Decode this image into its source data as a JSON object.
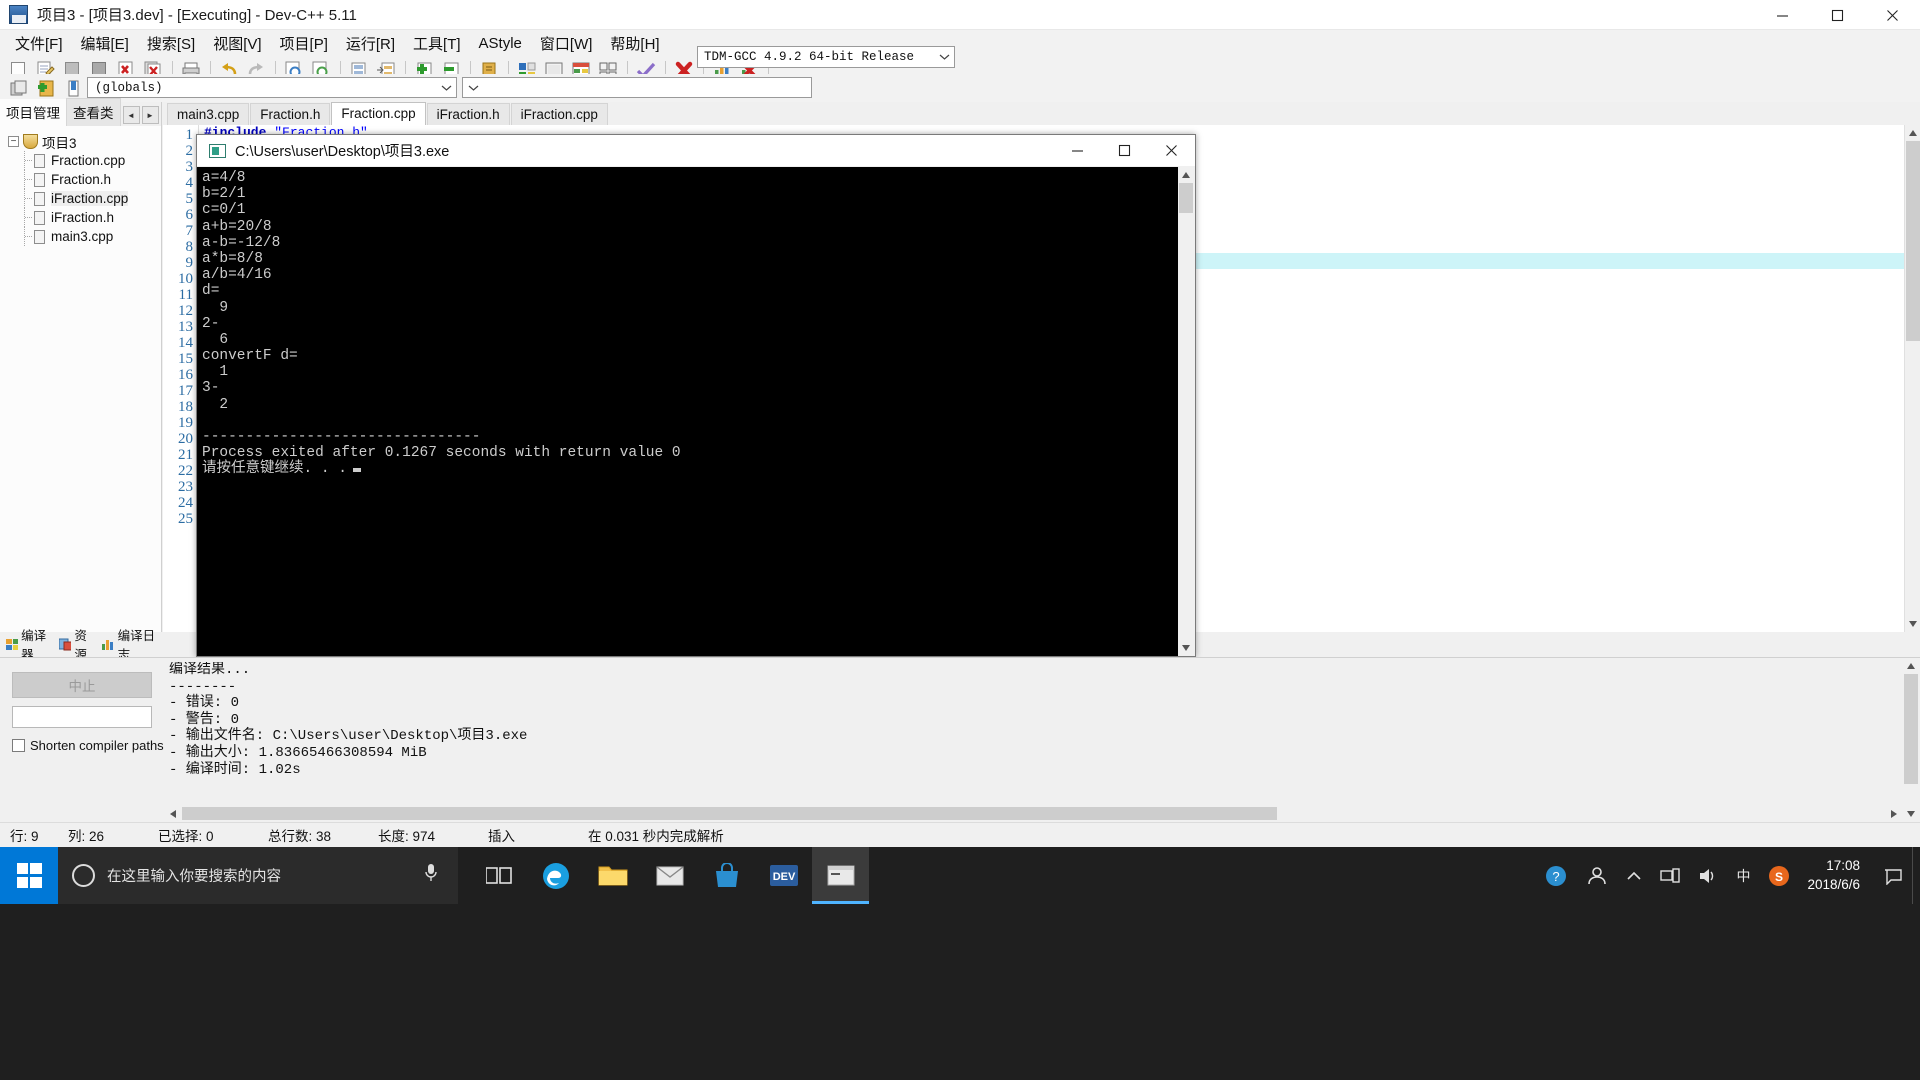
{
  "window": {
    "title": "项目3 - [项目3.dev] - [Executing] - Dev-C++ 5.11",
    "icon": "devcpp-icon",
    "minimize": "minimize-button",
    "maximize": "maximize-button",
    "close": "close-button"
  },
  "menubar": {
    "items": [
      {
        "label": "文件[F]"
      },
      {
        "label": "编辑[E]"
      },
      {
        "label": "搜索[S]"
      },
      {
        "label": "视图[V]"
      },
      {
        "label": "项目[P]"
      },
      {
        "label": "运行[R]"
      },
      {
        "label": "工具[T]"
      },
      {
        "label": "AStyle"
      },
      {
        "label": "窗口[W]"
      },
      {
        "label": "帮助[H]"
      }
    ]
  },
  "toolbar": {
    "compiler_combo": {
      "value": "TDM-GCC 4.9.2 64-bit Release",
      "arrow": "chevron-down-icon"
    },
    "globals_combo": {
      "value": "(globals)",
      "arrow": "chevron-down-icon"
    },
    "globals_combo2": {
      "value": "",
      "arrow": "chevron-down-icon"
    }
  },
  "left_panel": {
    "tabs": [
      {
        "label": "项目管理",
        "active": true
      },
      {
        "label": "查看类",
        "active": false
      }
    ],
    "nav_prev": "◄",
    "nav_next": "►",
    "tree": {
      "root": {
        "label": "项目3",
        "expander": "−"
      },
      "children": [
        {
          "label": "Fraction.cpp",
          "selected": false
        },
        {
          "label": "Fraction.h",
          "selected": false
        },
        {
          "label": "iFraction.cpp",
          "selected": true
        },
        {
          "label": "iFraction.h",
          "selected": false
        },
        {
          "label": "main3.cpp",
          "selected": false
        }
      ]
    },
    "bottom_tabs": [
      {
        "label": "编译器"
      },
      {
        "label": "资源"
      },
      {
        "label": "编译日志"
      }
    ]
  },
  "editor": {
    "tabs": [
      {
        "label": "main3.cpp",
        "active": false
      },
      {
        "label": "Fraction.h",
        "active": false
      },
      {
        "label": "Fraction.cpp",
        "active": true
      },
      {
        "label": "iFraction.h",
        "active": false
      },
      {
        "label": "iFraction.cpp",
        "active": false
      }
    ],
    "line_numbers": [
      1,
      2,
      3,
      4,
      5,
      6,
      7,
      8,
      9,
      10,
      11,
      12,
      13,
      14,
      15,
      16,
      17,
      18,
      19,
      20,
      21,
      22,
      23,
      24,
      25
    ],
    "highlighted_line": 9
  },
  "console": {
    "title": "C:\\Users\\user\\Desktop\\项目3.exe",
    "icon": "console-icon",
    "minimize": "minimize-button",
    "maximize": "maximize-button",
    "close": "close-button",
    "lines": [
      "a=4/8",
      "b=2/1",
      "c=0/1",
      "a+b=20/8",
      "a-b=-12/8",
      "a*b=8/8",
      "a/b=4/16",
      "d=",
      "  9",
      "2-",
      "  6",
      "convertF d=",
      "  1",
      "3-",
      "  2",
      "",
      "--------------------------------",
      "Process exited after 0.1267 seconds with return value 0",
      "请按任意键继续. . ."
    ]
  },
  "log_panel": {
    "abort_button": "中止",
    "progress_value": "",
    "shorten_checkbox_label": "Shorten compiler paths",
    "shorten_checked": false,
    "lines": [
      "编译结果...",
      "--------",
      "- 错误: 0",
      "- 警告: 0",
      "- 输出文件名: C:\\Users\\user\\Desktop\\项目3.exe",
      "- 输出大小: 1.83665466308594 MiB",
      "- 编译时间: 1.02s"
    ]
  },
  "statusbar": {
    "cells": [
      {
        "label": "行:",
        "value": "9"
      },
      {
        "label": "列:",
        "value": "26"
      },
      {
        "label": "已选择:",
        "value": "0"
      },
      {
        "label": "总行数:",
        "value": "38"
      },
      {
        "label": "长度:",
        "value": "974"
      },
      {
        "label": "插入",
        "value": ""
      },
      {
        "label": "在 0.031 秒内完成解析",
        "value": ""
      }
    ]
  },
  "taskbar": {
    "start_button": "start-button",
    "search_placeholder": "在这里输入你要搜索的内容",
    "mic_icon": "microphone-icon",
    "apps": [
      {
        "name": "task-view",
        "active": false
      },
      {
        "name": "edge-browser",
        "active": false
      },
      {
        "name": "file-explorer",
        "active": false
      },
      {
        "name": "mail",
        "active": false
      },
      {
        "name": "store",
        "active": false
      },
      {
        "name": "dev-cpp",
        "active": false
      },
      {
        "name": "console-window",
        "active": true
      }
    ],
    "tray": [
      {
        "name": "help-icon",
        "glyph": "?"
      },
      {
        "name": "people-icon",
        "glyph": "⚲"
      },
      {
        "name": "show-hidden-icons",
        "glyph": "⌃"
      },
      {
        "name": "network-icon",
        "glyph": "◰"
      },
      {
        "name": "volume-icon",
        "glyph": "🔊"
      },
      {
        "name": "ime-icon",
        "glyph": "中"
      },
      {
        "name": "sogou-icon",
        "glyph": "S"
      }
    ],
    "clock_time": "17:08",
    "clock_date": "2018/6/6"
  },
  "colors": {
    "accent": "#0078d7",
    "console_bg": "#000000",
    "console_fg": "#cccccc",
    "highlight_line": "#cdf4f8",
    "taskbar_bg": "#1f1f1f"
  }
}
